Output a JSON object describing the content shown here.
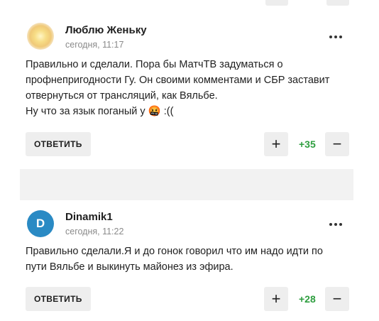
{
  "comments": [
    {
      "author": "Люблю Женьку",
      "time": "сегодня, 11:17",
      "avatar_type": "flower-image",
      "lines": [
        "Правильно и сделали. Пора бы МатчТВ задуматься о",
        "профнепригодности Гу. Он своими комментами и СБР заставит",
        "отвернуться от трансляций, как Вяльбе.",
        "Ну что за язык поганый у 🤬 :(("
      ],
      "reply_label": "ОТВЕТИТЬ",
      "score": "+35",
      "upvote_icon": "plus-icon",
      "downvote_icon": "minus-icon",
      "menu_icon": "more-dots-icon"
    },
    {
      "author": "Dinamik1",
      "time": "сегодня, 11:22",
      "avatar_letter": "D",
      "avatar_color": "#2a8ac4",
      "lines": [
        "Правильно сделали.Я и до гонок говорил что им надо идти по",
        "пути Вяльбе и выкинуть майонез из эфира."
      ],
      "reply_label": "ОТВЕТИТЬ",
      "score": "+28",
      "upvote_icon": "plus-icon",
      "downvote_icon": "minus-icon",
      "menu_icon": "more-dots-icon"
    }
  ],
  "colors": {
    "score_green": "#2e9e3f",
    "button_bg": "#eeeeee",
    "separator_bg": "#f2f2f2"
  }
}
